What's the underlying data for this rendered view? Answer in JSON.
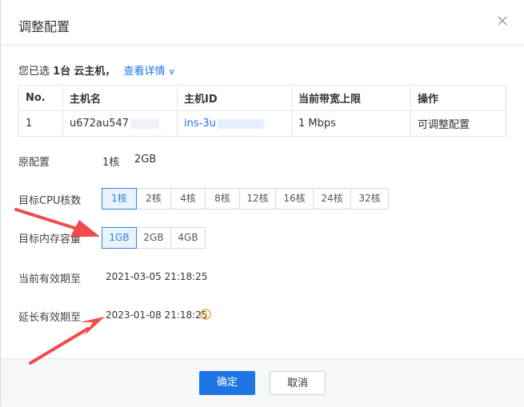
{
  "dialog": {
    "title": "调整配置"
  },
  "summary": {
    "prefix": "您已选",
    "count": "1台",
    "suffix": "云主机，",
    "detail_link": "查看详情"
  },
  "table": {
    "headers": [
      "No.",
      "主机名",
      "主机ID",
      "当前带宽上限",
      "操作"
    ],
    "rows": [
      {
        "no": "1",
        "hostname": "u672au547",
        "host_id": "ins-3u",
        "bandwidth": "1 Mbps",
        "action": "可调整配置"
      }
    ]
  },
  "original": {
    "label": "原配置",
    "cpu": "1核",
    "mem": "2GB"
  },
  "cpu": {
    "label": "目标CPU核数",
    "options": [
      "1核",
      "2核",
      "4核",
      "8核",
      "12核",
      "16核",
      "24核",
      "32核"
    ],
    "selected": "1核"
  },
  "memory": {
    "label": "目标内存容量",
    "options": [
      "1GB",
      "2GB",
      "4GB"
    ],
    "selected": "1GB"
  },
  "expiry": {
    "current_label": "当前有效期至",
    "current_value": "2021-03-05 21:18:25",
    "extended_label": "延长有效期至",
    "extended_value": "2023-01-08 21:18:25"
  },
  "footer": {
    "confirm": "确定",
    "cancel": "取消"
  },
  "colors": {
    "accent": "#1e75e6",
    "arrow": "#f04b4b",
    "info": "#e0a020"
  }
}
